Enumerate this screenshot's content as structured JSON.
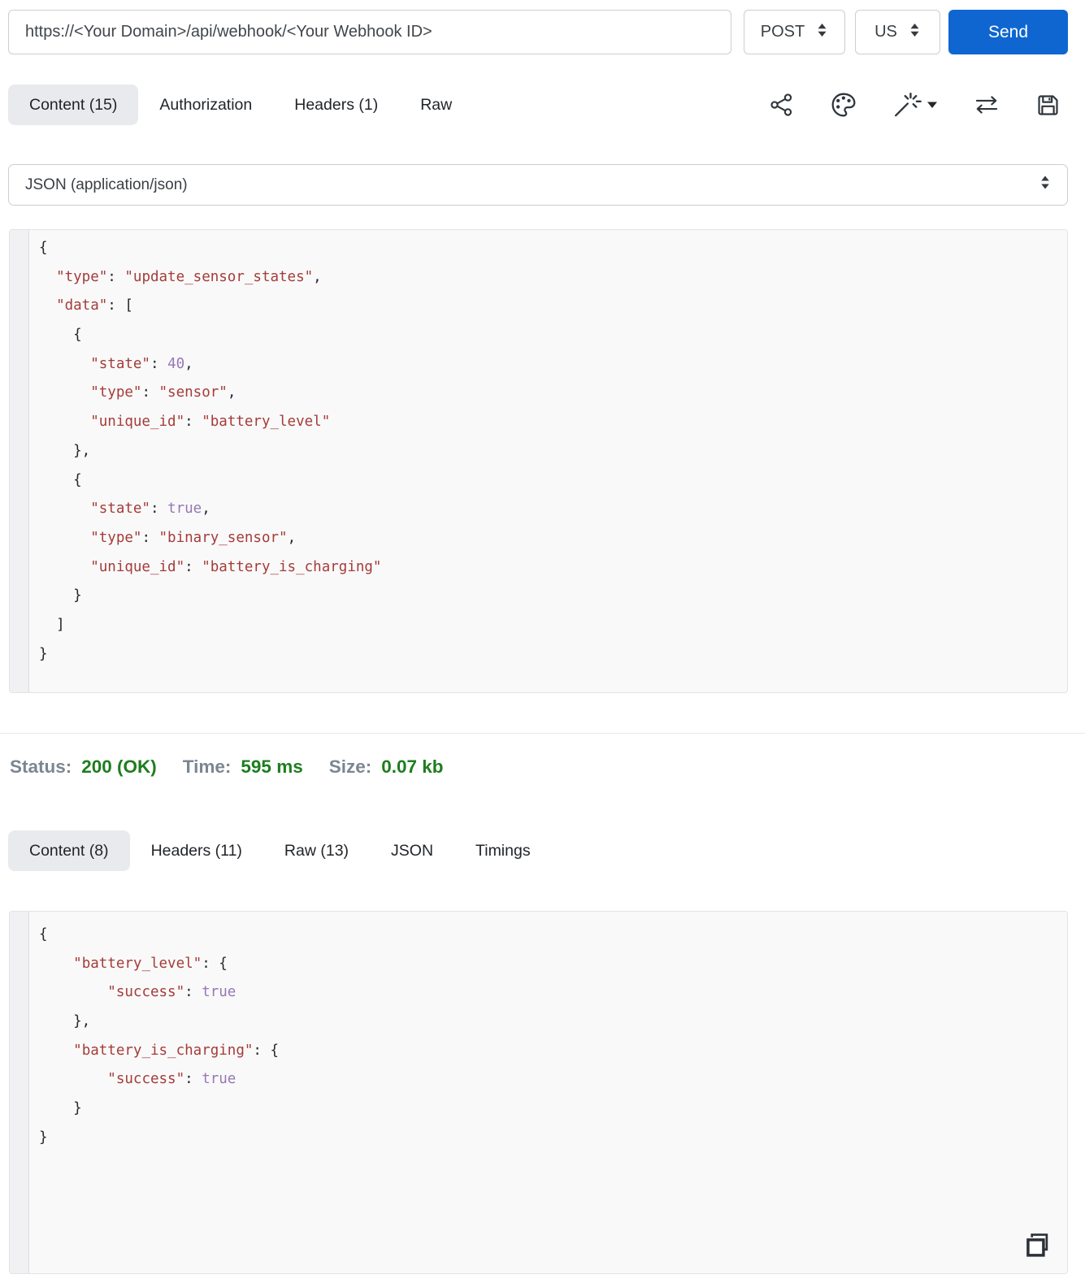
{
  "topbar": {
    "url_value": "https://<Your Domain>/api/webhook/<Your Webhook ID>",
    "method": "POST",
    "region": "US",
    "send_label": "Send"
  },
  "request_panel": {
    "tabs": [
      {
        "label": "Content (15)"
      },
      {
        "label": "Authorization"
      },
      {
        "label": "Headers (1)"
      },
      {
        "label": "Raw"
      }
    ],
    "toolbar_icons": [
      "share-icon",
      "palette-icon",
      "magic-wand-icon",
      "swap-arrows-icon",
      "save-icon"
    ],
    "body_type_selected": "JSON (application/json)",
    "code_lines": [
      [
        [
          "{",
          "p"
        ]
      ],
      [
        [
          "  ",
          "p"
        ],
        [
          "\"type\"",
          "s"
        ],
        [
          ": ",
          "p"
        ],
        [
          "\"update_sensor_states\"",
          "s"
        ],
        [
          ",",
          "p"
        ]
      ],
      [
        [
          "  ",
          "p"
        ],
        [
          "\"data\"",
          "s"
        ],
        [
          ": [",
          "p"
        ]
      ],
      [
        [
          "    {",
          "p"
        ]
      ],
      [
        [
          "      ",
          "p"
        ],
        [
          "\"state\"",
          "s"
        ],
        [
          ": ",
          "p"
        ],
        [
          "40",
          "a"
        ],
        [
          ",",
          "p"
        ]
      ],
      [
        [
          "      ",
          "p"
        ],
        [
          "\"type\"",
          "s"
        ],
        [
          ": ",
          "p"
        ],
        [
          "\"sensor\"",
          "s"
        ],
        [
          ",",
          "p"
        ]
      ],
      [
        [
          "      ",
          "p"
        ],
        [
          "\"unique_id\"",
          "s"
        ],
        [
          ": ",
          "p"
        ],
        [
          "\"battery_level\"",
          "s"
        ]
      ],
      [
        [
          "    },",
          "p"
        ]
      ],
      [
        [
          "    {",
          "p"
        ]
      ],
      [
        [
          "      ",
          "p"
        ],
        [
          "\"state\"",
          "s"
        ],
        [
          ": ",
          "p"
        ],
        [
          "true",
          "a"
        ],
        [
          ",",
          "p"
        ]
      ],
      [
        [
          "      ",
          "p"
        ],
        [
          "\"type\"",
          "s"
        ],
        [
          ": ",
          "p"
        ],
        [
          "\"binary_sensor\"",
          "s"
        ],
        [
          ",",
          "p"
        ]
      ],
      [
        [
          "      ",
          "p"
        ],
        [
          "\"unique_id\"",
          "s"
        ],
        [
          ": ",
          "p"
        ],
        [
          "\"battery_is_charging\"",
          "s"
        ]
      ],
      [
        [
          "    }",
          "p"
        ]
      ],
      [
        [
          "  ]",
          "p"
        ]
      ],
      [
        [
          "}",
          "p"
        ]
      ]
    ]
  },
  "status_bar": {
    "items": [
      {
        "label": "Status:",
        "value": "200 (OK)"
      },
      {
        "label": "Time:",
        "value": "595 ms"
      },
      {
        "label": "Size:",
        "value": "0.07 kb"
      }
    ]
  },
  "response_panel": {
    "tabs": [
      {
        "label": "Content (8)"
      },
      {
        "label": "Headers (11)"
      },
      {
        "label": "Raw (13)"
      },
      {
        "label": "JSON"
      },
      {
        "label": "Timings"
      }
    ],
    "code_lines": [
      [
        [
          "{",
          "p"
        ]
      ],
      [
        [
          "    ",
          "p"
        ],
        [
          "\"battery_level\"",
          "s"
        ],
        [
          ": {",
          "p"
        ]
      ],
      [
        [
          "        ",
          "p"
        ],
        [
          "\"success\"",
          "s"
        ],
        [
          ": ",
          "p"
        ],
        [
          "true",
          "a"
        ]
      ],
      [
        [
          "    },",
          "p"
        ]
      ],
      [
        [
          "    ",
          "p"
        ],
        [
          "\"battery_is_charging\"",
          "s"
        ],
        [
          ": {",
          "p"
        ]
      ],
      [
        [
          "        ",
          "p"
        ],
        [
          "\"success\"",
          "s"
        ],
        [
          ": ",
          "p"
        ],
        [
          "true",
          "a"
        ]
      ],
      [
        [
          "    }",
          "p"
        ]
      ],
      [
        [
          "}",
          "p"
        ]
      ]
    ]
  },
  "colors": {
    "accent_blue": "#0f66d0",
    "success_green": "#1e7d1e",
    "code_string_red": "#a53c37",
    "code_atom_purple": "#9678b4",
    "active_tab_bg": "#e9eaed"
  }
}
